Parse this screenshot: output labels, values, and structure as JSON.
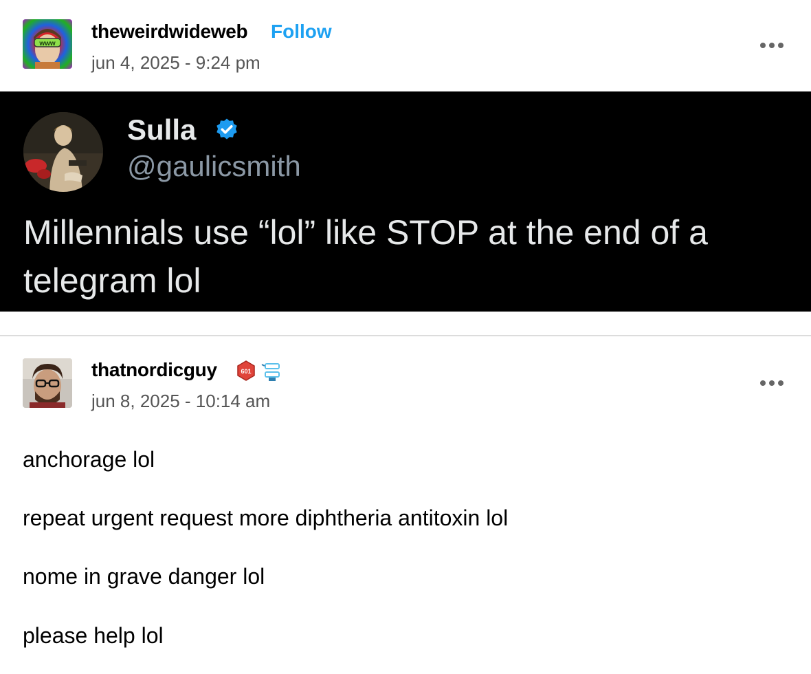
{
  "post1": {
    "username": "theweirdwideweb",
    "follow_label": "Follow",
    "timestamp": "jun 4, 2025 - 9:24 pm",
    "avatar_badge": "www",
    "icons": {
      "more": "more-options-icon"
    }
  },
  "tweet": {
    "name": "Sulla",
    "handle": "@gaulicsmith",
    "text": "Millennials use “lol” like STOP at the end of a telegram lol",
    "verified_color": "#1d9bf0"
  },
  "post2": {
    "username": "thatnordicguy",
    "timestamp": "jun 8, 2025 - 10:14 am",
    "badge1_text": "601",
    "icons": {
      "more": "more-options-icon"
    },
    "lines": [
      "anchorage lol",
      "repeat urgent request more diphtheria antitoxin lol",
      "nome in grave danger lol",
      "please help lol"
    ]
  },
  "colors": {
    "follow": "#1da1f2",
    "tweet_bg": "#000000",
    "divider": "#dcdcdc"
  }
}
